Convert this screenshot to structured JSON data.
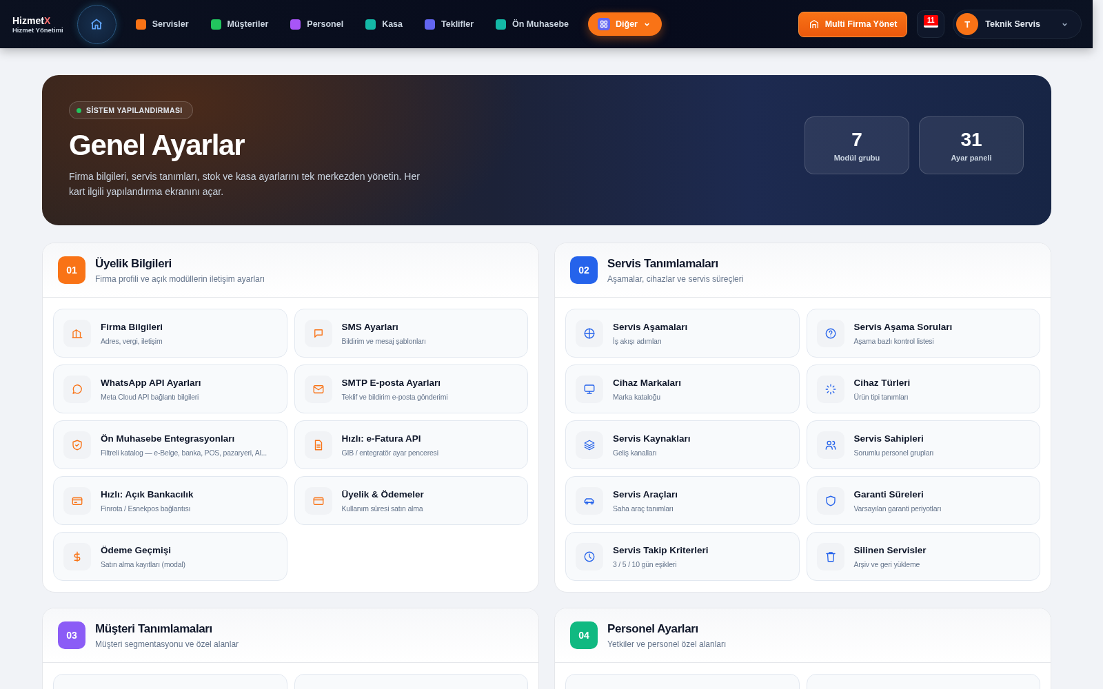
{
  "brand": {
    "name": "Hizmet",
    "mark": "X",
    "subtitle": "Hizmet Yönetimi"
  },
  "home": {
    "selected": true
  },
  "nav": [
    {
      "label": "Servisler",
      "color": "#f97316",
      "selected": false
    },
    {
      "label": "Müşteriler",
      "color": "#22c55e",
      "selected": false
    },
    {
      "label": "Personel",
      "color": "#a855f7",
      "selected": false
    },
    {
      "label": "Kasa",
      "color": "#14b8a6",
      "selected": false
    },
    {
      "label": "Teklifler",
      "color": "#6366f1",
      "selected": false
    },
    {
      "label": "Ön Muhasebe",
      "color": "#14b8a6",
      "selected": false
    }
  ],
  "more_menu": {
    "label": "Diğer"
  },
  "multi_firm_button": {
    "label": "Multi Firma Yönet"
  },
  "notifications": {
    "count": "11"
  },
  "user": {
    "initial": "T",
    "name": "Teknik Servis"
  },
  "hero": {
    "badge": "SİSTEM YAPILANDIRMASI",
    "title": "Genel Ayarlar",
    "description": "Firma bilgileri, servis tanımları, stok ve kasa ayarlarını tek merkezden yönetin. Her kart ilgili yapılandırma ekranını açar.",
    "stats": [
      {
        "value": "7",
        "label": "Modül grubu"
      },
      {
        "value": "31",
        "label": "Ayar paneli"
      }
    ]
  },
  "sections": [
    {
      "number": "01",
      "title": "Üyelik Bilgileri",
      "subtitle": "Firma profili ve açık modüllerin iletişim ayarları",
      "color": "#f97316",
      "items": [
        {
          "title": "Firma Bilgileri",
          "subtitle": "Adres, vergi, iletişim"
        },
        {
          "title": "SMS Ayarları",
          "subtitle": "Bildirim ve mesaj şablonları"
        },
        {
          "title": "WhatsApp API Ayarları",
          "subtitle": "Meta Cloud API bağlantı bilgileri"
        },
        {
          "title": "SMTP E-posta Ayarları",
          "subtitle": "Teklif ve bildirim e-posta gönderimi"
        },
        {
          "title": "Ön Muhasebe Entegrasyonları",
          "subtitle": "Filtreli katalog — e-Belge, banka, POS, pazaryeri, Al..."
        },
        {
          "title": "Hızlı: e-Fatura API",
          "subtitle": "GIB / entegratör ayar penceresi"
        },
        {
          "title": "Hızlı: Açık Bankacılık",
          "subtitle": "Finrota / Esnekpos bağlantısı"
        },
        {
          "title": "Üyelik & Ödemeler",
          "subtitle": "Kullanım süresi satın alma"
        },
        {
          "title": "Ödeme Geçmişi",
          "subtitle": "Satın alma kayıtları (modal)"
        }
      ]
    },
    {
      "number": "02",
      "title": "Servis Tanımlamaları",
      "subtitle": "Aşamalar, cihazlar ve servis süreçleri",
      "color": "#2563eb",
      "items": [
        {
          "title": "Servis Aşamaları",
          "subtitle": "İş akışı adımları"
        },
        {
          "title": "Servis Aşama Soruları",
          "subtitle": "Aşama bazlı kontrol listesi"
        },
        {
          "title": "Cihaz Markaları",
          "subtitle": "Marka kataloğu"
        },
        {
          "title": "Cihaz Türleri",
          "subtitle": "Ürün tipi tanımları"
        },
        {
          "title": "Servis Kaynakları",
          "subtitle": "Geliş kanalları"
        },
        {
          "title": "Servis Sahipleri",
          "subtitle": "Sorumlu personel grupları"
        },
        {
          "title": "Servis Araçları",
          "subtitle": "Saha araç tanımları"
        },
        {
          "title": "Garanti Süreleri",
          "subtitle": "Varsayılan garanti periyotları"
        },
        {
          "title": "Servis Takip Kriterleri",
          "subtitle": "3 / 5 / 10 gün eşikleri"
        },
        {
          "title": "Silinen Servisler",
          "subtitle": "Arşiv ve geri yükleme"
        }
      ]
    },
    {
      "number": "03",
      "title": "Müşteri Tanımlamaları",
      "subtitle": "Müşteri segmentasyonu ve özel alanlar",
      "color": "#8b5cf6"
    },
    {
      "number": "04",
      "title": "Personel Ayarları",
      "subtitle": "Yetkiler ve personel özel alanları",
      "color": "#10b981"
    }
  ]
}
